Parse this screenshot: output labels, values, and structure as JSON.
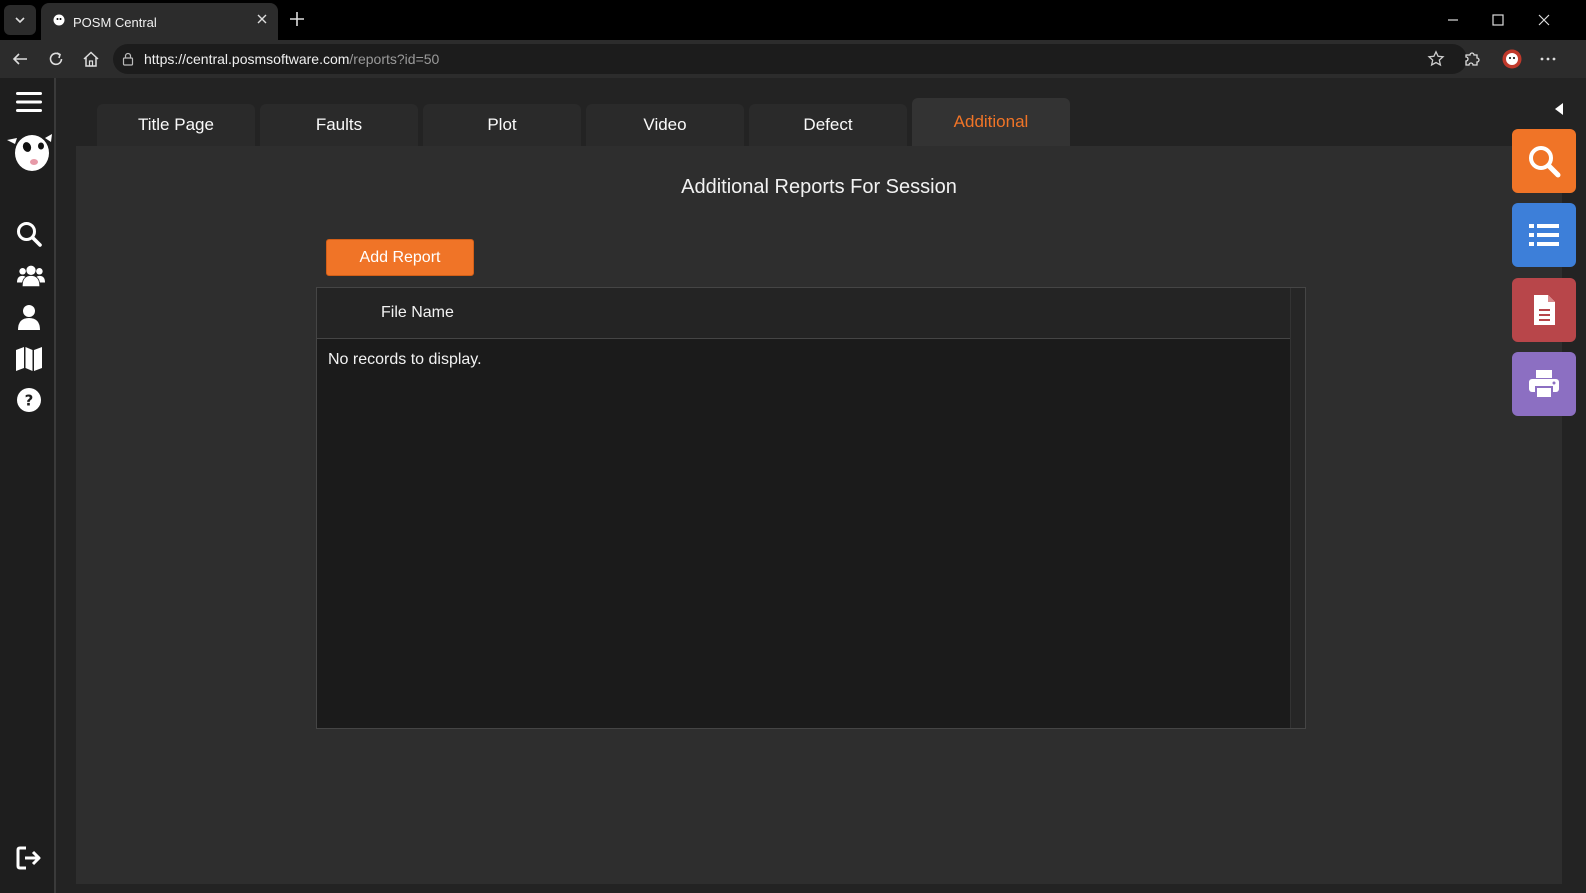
{
  "browser": {
    "tab_title": "POSM Central",
    "url_host": "https://central.posmsoftware.com",
    "url_path": "/reports?id=50"
  },
  "app": {
    "tabs": [
      {
        "label": "Title Page",
        "active": false
      },
      {
        "label": "Faults",
        "active": false
      },
      {
        "label": "Plot",
        "active": false
      },
      {
        "label": "Video",
        "active": false
      },
      {
        "label": "Defect",
        "active": false
      },
      {
        "label": "Additional",
        "active": true
      }
    ],
    "heading": "Additional Reports For Session",
    "add_report_label": "Add Report",
    "grid": {
      "columns": [
        "File Name"
      ],
      "empty_message": "No records to display."
    },
    "left_nav_icons": [
      "menu-icon",
      "posm-logo",
      "search-icon",
      "users-group-icon",
      "user-icon",
      "map-icon",
      "help-icon",
      "logout-icon"
    ],
    "side_actions": [
      {
        "icon": "search-icon",
        "color": "#f07427"
      },
      {
        "icon": "list-icon",
        "color": "#3d7fd9"
      },
      {
        "icon": "document-icon",
        "color": "#b8464a"
      },
      {
        "icon": "printer-icon",
        "color": "#8c6fc2"
      }
    ],
    "accent_color": "#f07427"
  }
}
